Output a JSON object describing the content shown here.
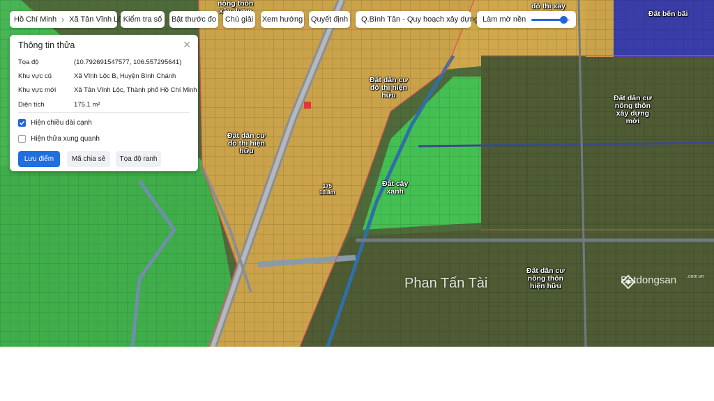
{
  "toolbar": {
    "breadcrumb": [
      "Hồ Chí Minh",
      "Xã Tân Vĩnh Lộc"
    ],
    "buttons": [
      "Kiểm tra số",
      "Bật thước đo",
      "Chú giải",
      "Xem hướng",
      "Quyết định"
    ],
    "layer_select": "Q.Bình Tân - Quy hoạch xây dựng",
    "blur_label": "Làm mờ nền",
    "blur_level": 0.82
  },
  "panel": {
    "title": "Thông tin thửa",
    "fields": [
      {
        "key": "Tọa độ",
        "value": "(10.792691547577, 106.557295641)"
      },
      {
        "key": "Khu vực cũ",
        "value": "Xã Vĩnh Lộc B, Huyện Bình Chánh"
      },
      {
        "key": "Khu vực mới",
        "value": "Xã Tân Vĩnh Lộc, Thành phố Hồ Chí Minh"
      },
      {
        "key": "Diện tích",
        "value": "175.1 m²"
      }
    ],
    "checkboxes": [
      {
        "label": "Hiện chiều dài cạnh",
        "checked": true
      },
      {
        "label": "Hiện thửa xung quanh",
        "checked": false
      }
    ],
    "actions": [
      "Lưu điểm",
      "Mã chia sẻ",
      "Tọa độ ranh"
    ]
  },
  "map": {
    "zone_labels": [
      "nông thôn\nxây dựng",
      "đô thị xây",
      "Đất bến bãi",
      "Đất dân cư\nđô thị hiện\nhữu",
      "Đất dân cư\nđô thị hiện\nhữu",
      "Đất dân cư\nnông thôn\nxây dựng\nmới",
      "Đất cây\nxanh",
      "Đất dân cư\nnông thôn\nhiện hữu"
    ],
    "parcel_label": "175\n10.8m",
    "watermark_name": "Phan Tấn Tài",
    "brand": "Batdongsan",
    "brand_sub": ".com.vn",
    "colors": {
      "residential_urban": "#c9a24a",
      "green": "#3fae4a",
      "rural": "#5a6a3a",
      "port": "#3a3da8",
      "selected_parcel": "#e8323c"
    }
  }
}
